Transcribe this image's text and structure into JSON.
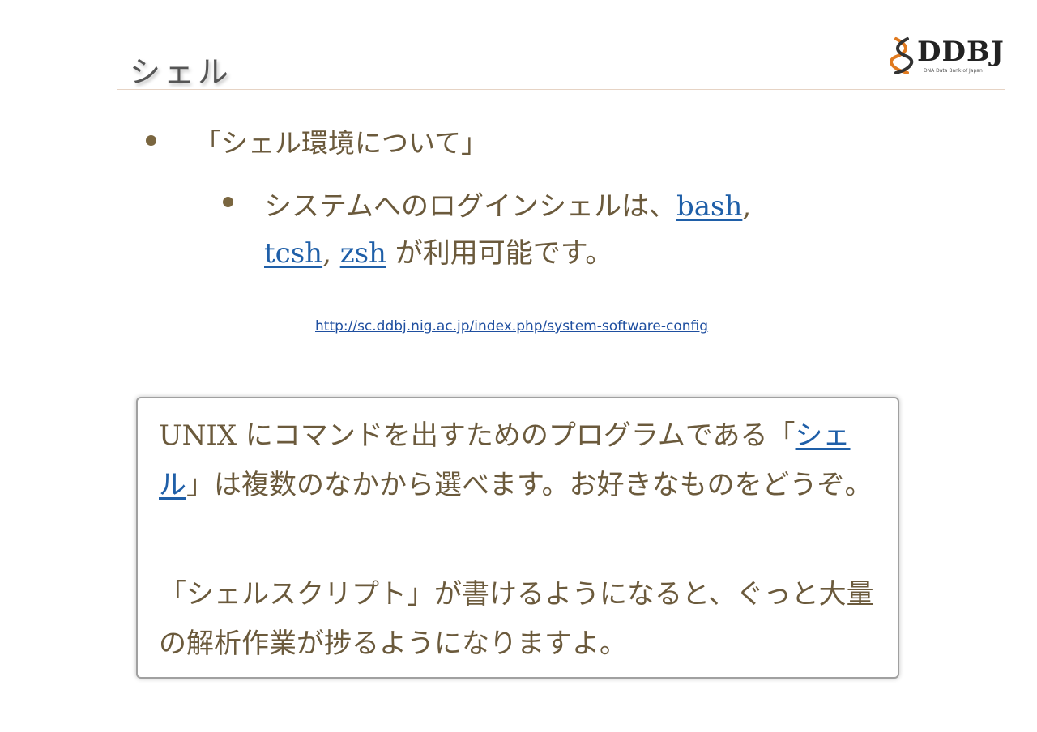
{
  "slide": {
    "title": "シェル",
    "logo": {
      "text": "DDBJ",
      "subtitle": "DNA Data Bank of Japan"
    },
    "bullet_level1": "「シェル環境について」",
    "bullet_level2": {
      "prefix": "システムへのログインシェルは、",
      "link_bash": "bash",
      "sep1": ",",
      "link_tcsh": "tcsh",
      "sep2": ", ",
      "link_zsh": "zsh",
      "suffix": " が利用可能です。"
    },
    "url": "http://sc.ddbj.nig.ac.jp/index.php/system-software-config",
    "note": {
      "p1_start": "UNIX にコマンドを出すためのプログラムである「",
      "p1_link": "シェル",
      "p1_end": "」は複数のなかから選べます。お好きなものをどうぞ。",
      "p2": "「シェルスクリプト」が書けるようになると、ぐっと大量の解析作業が捗るようになりますよ。"
    }
  },
  "colors": {
    "text": "#6b5a3c",
    "link": "#1f5fa8",
    "title": "#555555"
  }
}
